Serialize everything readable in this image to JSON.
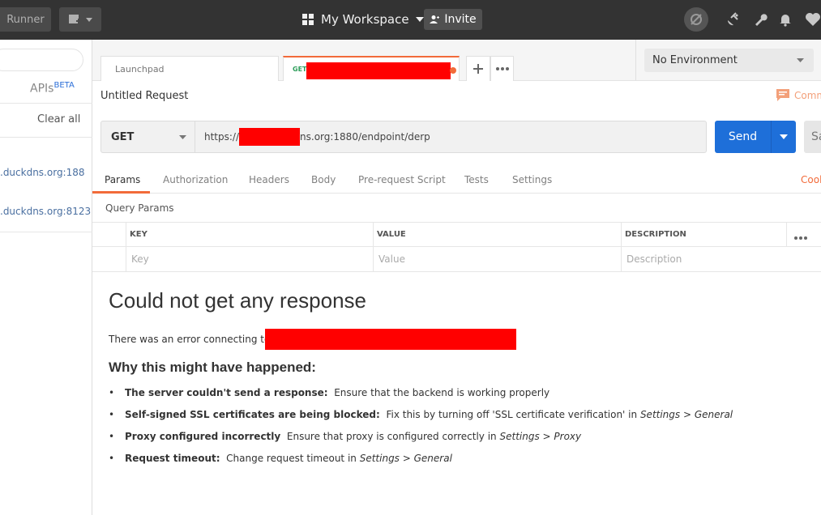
{
  "topbar": {
    "runner_label": "Runner",
    "workspace_label": "My Workspace",
    "invite_label": "Invite"
  },
  "sidebar": {
    "apis_label": "APIs",
    "apis_badge": "BETA",
    "clear_all_label": "Clear all",
    "history": [
      {
        "text": ".duckdns.org:188"
      },
      {
        "text": ".duckdns.org:8123"
      }
    ]
  },
  "tabs": [
    {
      "label": "Launchpad"
    },
    {
      "method": "GET",
      "label": "",
      "unsaved": true
    }
  ],
  "environment": {
    "selected": "No Environment"
  },
  "request": {
    "title": "Untitled Request",
    "comments_label": "Comm",
    "method": "GET",
    "url_prefix": "https://",
    "url_suffix": "ns.org:1880/endpoint/derp",
    "send_label": "Send",
    "save_label": "Sa"
  },
  "subtabs": [
    "Params",
    "Authorization",
    "Headers",
    "Body",
    "Pre-request Script",
    "Tests",
    "Settings"
  ],
  "cookies_label": "Cook",
  "params": {
    "title": "Query Params",
    "headers": [
      "KEY",
      "VALUE",
      "DESCRIPTION"
    ],
    "placeholders": [
      "Key",
      "Value",
      "Description"
    ]
  },
  "response": {
    "title": "Could not get any response",
    "message": "There was an error connecting to",
    "why_title": "Why this might have happened:",
    "reasons": [
      {
        "bold": "The server couldn't send a response:",
        "text": "Ensure that the backend is working properly",
        "italic": ""
      },
      {
        "bold": "Self-signed SSL certificates are being blocked:",
        "text": "Fix this by turning off 'SSL certificate verification' in",
        "italic": "Settings > General"
      },
      {
        "bold": "Proxy configured incorrectly",
        "text": "Ensure that proxy is configured correctly in",
        "italic": "Settings > Proxy"
      },
      {
        "bold": "Request timeout:",
        "text": "Change request timeout in",
        "italic": "Settings > General"
      }
    ]
  },
  "colors": {
    "topbar": "#333333",
    "accent_orange": "#f26b3a",
    "send_blue": "#1e6fd9",
    "redaction": "#ff0000"
  }
}
